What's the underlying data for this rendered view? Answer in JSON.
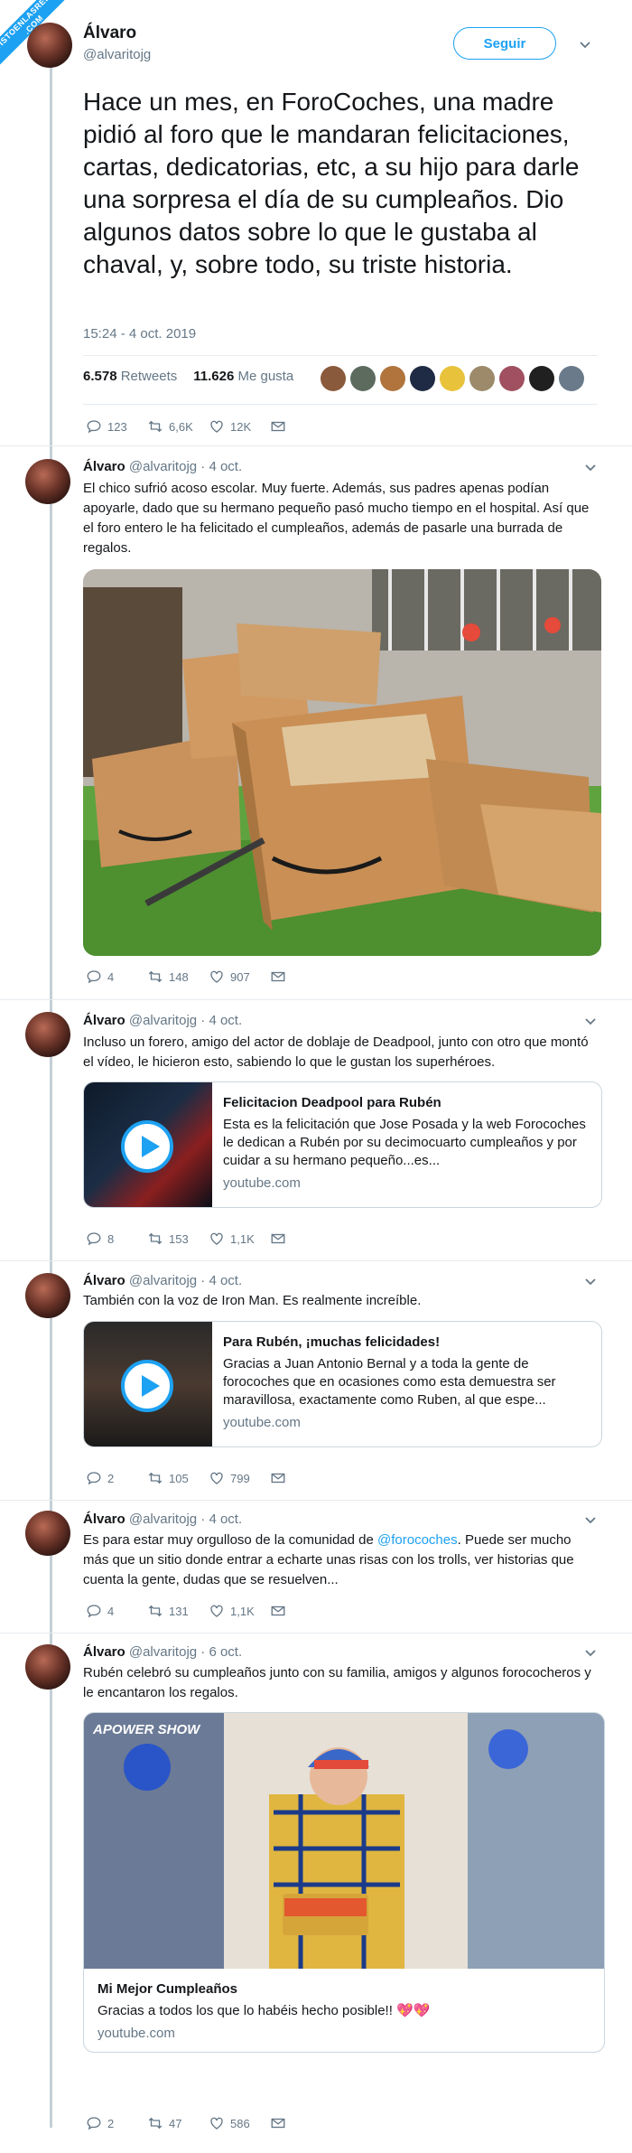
{
  "watermark": {
    "line1": "VISTOENLASREDES",
    "line2": ".COM"
  },
  "main_tweet": {
    "name": "Álvaro",
    "handle": "@alvaritojg",
    "follow_label": "Seguir",
    "text": "Hace un mes, en ForoCoches, una madre pidió al foro que le mandaran felicitaciones, cartas, dedicatorias, etc, a su hijo para darle una sorpresa el día de su cumpleaños. Dio algunos datos sobre lo que le gustaba al chaval, y, sobre todo, su triste historia.",
    "date": "15:24 - 4 oct. 2019",
    "retweets_count": "6.578",
    "retweets_label": "Retweets",
    "likes_count": "11.626",
    "likes_label": "Me gusta",
    "replies": "123",
    "rts": "6,6K",
    "likes": "12K"
  },
  "replies": [
    {
      "name": "Álvaro",
      "handle": "@alvaritojg",
      "date": "· 4 oct.",
      "text": "El chico sufrió acoso escolar. Muy fuerte. Además, sus padres apenas podían apoyarle, dado que su hermano pequeño pasó mucho tiempo en el hospital. Así que el foro entero le ha felicitado el cumpleaños, además de pasarle una burrada de regalos.",
      "replies": "4",
      "rts": "148",
      "likes": "907"
    },
    {
      "name": "Álvaro",
      "handle": "@alvaritojg",
      "date": "· 4 oct.",
      "text": "Incluso un forero, amigo del actor de doblaje de Deadpool, junto con otro que montó el vídeo, le hicieron esto, sabiendo lo que le gustan los superhéroes.",
      "card": {
        "title": "Felicitacion Deadpool para Rubén",
        "desc": "Esta es la felicitación que Jose Posada y la web Forocoches le dedican a Rubén por su decimocuarto cumpleaños y por cuidar a su hermano pequeño...es...",
        "url": "youtube.com"
      },
      "replies": "8",
      "rts": "153",
      "likes": "1,1K"
    },
    {
      "name": "Álvaro",
      "handle": "@alvaritojg",
      "date": "· 4 oct.",
      "text": "También con la voz de Iron Man. Es realmente increíble.",
      "card": {
        "title": "Para Rubén, ¡muchas felicidades!",
        "desc": "Gracias a Juan Antonio Bernal y a toda la gente de forocoches que en ocasiones como esta demuestra ser maravillosa, exactamente como Ruben, al que espe...",
        "url": "youtube.com"
      },
      "replies": "2",
      "rts": "105",
      "likes": "799"
    },
    {
      "name": "Álvaro",
      "handle": "@alvaritojg",
      "date": "· 4 oct.",
      "text_before": "Es para estar muy orgulloso de la comunidad de ",
      "mention": "@forocoches",
      "text_after": ". Puede ser mucho más que un sitio donde entrar a echarte unas risas con los trolls, ver historias que cuenta la gente, dudas que se resuelven...",
      "replies": "4",
      "rts": "131",
      "likes": "1,1K"
    },
    {
      "name": "Álvaro",
      "handle": "@alvaritojg",
      "date": "· 6 oct.",
      "text": "Rubén celebró su cumpleaños junto con su familia, amigos y algunos forococheros y le encantaron los regalos.",
      "media": {
        "logo": "APOWER SHOW",
        "title": "Mi Mejor Cumpleaños",
        "desc": "Gracias a todos los que lo habéis hecho posible!! 💖💖",
        "url": "youtube.com"
      },
      "replies": "2",
      "rts": "47",
      "likes": "586"
    }
  ],
  "colors": {
    "accent": "#1da1f2",
    "muted": "#657786",
    "text": "#14171a",
    "border": "#e6ecf0"
  }
}
